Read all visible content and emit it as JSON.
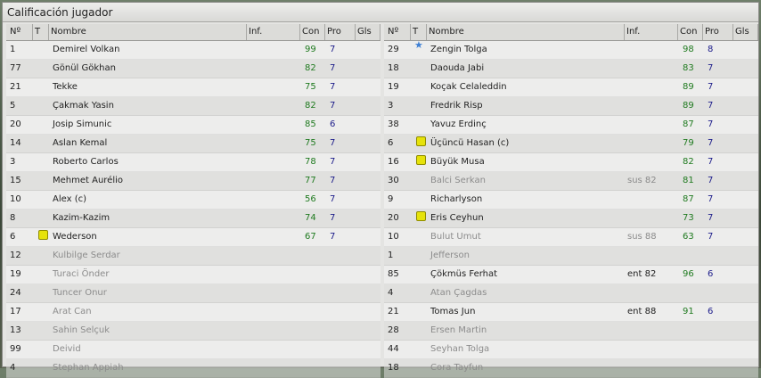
{
  "title": "Calificación jugador",
  "headers": {
    "num": "Nº",
    "t": "T",
    "name": "Nombre",
    "inf": "Inf.",
    "con": "Con",
    "pro": "Pro",
    "gls": "Gls"
  },
  "left": [
    {
      "num": "1",
      "name": "Demirel Volkan",
      "inf": "",
      "con": "99",
      "pro": "7",
      "icon": "",
      "dim": false
    },
    {
      "num": "77",
      "name": "Gönül Gökhan",
      "inf": "",
      "con": "82",
      "pro": "7",
      "icon": "",
      "dim": false
    },
    {
      "num": "21",
      "name": "Tekke",
      "inf": "",
      "con": "75",
      "pro": "7",
      "icon": "",
      "dim": false
    },
    {
      "num": "5",
      "name": "Çakmak Yasin",
      "inf": "",
      "con": "82",
      "pro": "7",
      "icon": "",
      "dim": false
    },
    {
      "num": "20",
      "name": "Josip Simunic",
      "inf": "",
      "con": "85",
      "pro": "6",
      "icon": "",
      "dim": false
    },
    {
      "num": "14",
      "name": "Aslan Kemal",
      "inf": "",
      "con": "75",
      "pro": "7",
      "icon": "",
      "dim": false
    },
    {
      "num": "3",
      "name": "Roberto Carlos",
      "inf": "",
      "con": "78",
      "pro": "7",
      "icon": "",
      "dim": false
    },
    {
      "num": "15",
      "name": "Mehmet Aurélio",
      "inf": "",
      "con": "77",
      "pro": "7",
      "icon": "",
      "dim": false
    },
    {
      "num": "10",
      "name": "Alex (c)",
      "inf": "",
      "con": "56",
      "pro": "7",
      "icon": "",
      "dim": false
    },
    {
      "num": "8",
      "name": "Kazim-Kazim",
      "inf": "",
      "con": "74",
      "pro": "7",
      "icon": "",
      "dim": false
    },
    {
      "num": "6",
      "name": "Wederson",
      "inf": "",
      "con": "67",
      "pro": "7",
      "icon": "yellow-card",
      "dim": false
    },
    {
      "num": "12",
      "name": "Kulbilge Serdar",
      "inf": "",
      "con": "",
      "pro": "",
      "icon": "",
      "dim": true
    },
    {
      "num": "19",
      "name": "Turaci Önder",
      "inf": "",
      "con": "",
      "pro": "",
      "icon": "",
      "dim": true
    },
    {
      "num": "24",
      "name": "Tuncer Onur",
      "inf": "",
      "con": "",
      "pro": "",
      "icon": "",
      "dim": true
    },
    {
      "num": "17",
      "name": "Arat Can",
      "inf": "",
      "con": "",
      "pro": "",
      "icon": "",
      "dim": true
    },
    {
      "num": "13",
      "name": "Sahin Selçuk",
      "inf": "",
      "con": "",
      "pro": "",
      "icon": "",
      "dim": true
    },
    {
      "num": "99",
      "name": "Deivid",
      "inf": "",
      "con": "",
      "pro": "",
      "icon": "",
      "dim": true
    },
    {
      "num": "4",
      "name": "Stephan Appiah",
      "inf": "",
      "con": "",
      "pro": "",
      "icon": "",
      "dim": true
    }
  ],
  "right": [
    {
      "num": "29",
      "name": "Zengin Tolga",
      "inf": "",
      "con": "98",
      "pro": "8",
      "icon": "star",
      "dim": false
    },
    {
      "num": "18",
      "name": "Daouda Jabi",
      "inf": "",
      "con": "83",
      "pro": "7",
      "icon": "",
      "dim": false
    },
    {
      "num": "19",
      "name": "Koçak Celaleddin",
      "inf": "",
      "con": "89",
      "pro": "7",
      "icon": "",
      "dim": false
    },
    {
      "num": "3",
      "name": "Fredrik Risp",
      "inf": "",
      "con": "89",
      "pro": "7",
      "icon": "",
      "dim": false
    },
    {
      "num": "38",
      "name": "Yavuz Erdinç",
      "inf": "",
      "con": "87",
      "pro": "7",
      "icon": "",
      "dim": false
    },
    {
      "num": "6",
      "name": "Üçüncü Hasan (c)",
      "inf": "",
      "con": "79",
      "pro": "7",
      "icon": "yellow-card",
      "dim": false
    },
    {
      "num": "16",
      "name": "Büyük Musa",
      "inf": "",
      "con": "82",
      "pro": "7",
      "icon": "yellow-card",
      "dim": false
    },
    {
      "num": "30",
      "name": "Balci Serkan",
      "inf": "sus 82",
      "con": "81",
      "pro": "7",
      "icon": "",
      "dim": true
    },
    {
      "num": "9",
      "name": "Richarlyson",
      "inf": "",
      "con": "87",
      "pro": "7",
      "icon": "",
      "dim": false
    },
    {
      "num": "20",
      "name": "Eris Ceyhun",
      "inf": "",
      "con": "73",
      "pro": "7",
      "icon": "yellow-card",
      "dim": false
    },
    {
      "num": "10",
      "name": "Bulut Umut",
      "inf": "sus 88",
      "con": "63",
      "pro": "7",
      "icon": "",
      "dim": true
    },
    {
      "num": "1",
      "name": "Jefferson",
      "inf": "",
      "con": "",
      "pro": "",
      "icon": "",
      "dim": true
    },
    {
      "num": "85",
      "name": "Çökmüs Ferhat",
      "inf": "ent 82",
      "con": "96",
      "pro": "6",
      "icon": "",
      "dim": false
    },
    {
      "num": "4",
      "name": "Atan Çagdas",
      "inf": "",
      "con": "",
      "pro": "",
      "icon": "",
      "dim": true
    },
    {
      "num": "21",
      "name": "Tomas Jun",
      "inf": "ent 88",
      "con": "91",
      "pro": "6",
      "icon": "",
      "dim": false
    },
    {
      "num": "28",
      "name": "Ersen Martin",
      "inf": "",
      "con": "",
      "pro": "",
      "icon": "",
      "dim": true
    },
    {
      "num": "44",
      "name": "Seyhan Tolga",
      "inf": "",
      "con": "",
      "pro": "",
      "icon": "",
      "dim": true
    },
    {
      "num": "18",
      "name": "Cora Tayfun",
      "inf": "",
      "con": "",
      "pro": "",
      "icon": "",
      "dim": true
    }
  ]
}
